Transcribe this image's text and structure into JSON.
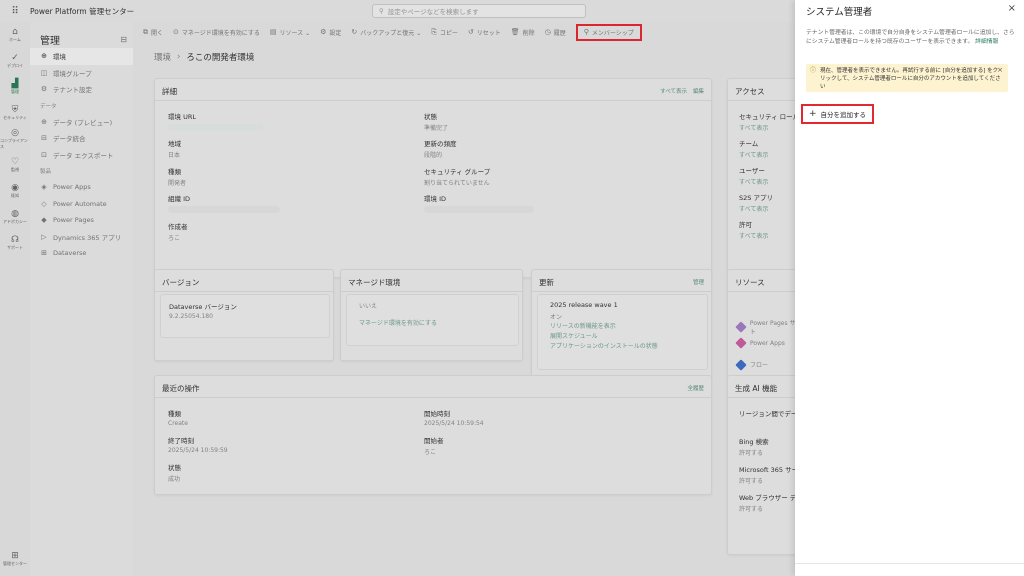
{
  "topbar": {
    "app_title": "Power Platform 管理センター",
    "search_placeholder": "設定やページなどを検索します"
  },
  "rail": {
    "items": [
      {
        "icon": "home-icon",
        "glyph": "⌂",
        "label": "ホーム"
      },
      {
        "icon": "deploy-icon",
        "glyph": "✓",
        "label": "デプロイ"
      },
      {
        "icon": "manage-icon",
        "glyph": "▟",
        "label": "管理"
      },
      {
        "icon": "security-icon",
        "glyph": "⛨",
        "label": "セキュリティ"
      },
      {
        "icon": "compliance-icon",
        "glyph": "◎",
        "label": "コンプライアンス"
      },
      {
        "icon": "monitor-icon",
        "glyph": "♡",
        "label": "監視"
      },
      {
        "icon": "reports-icon",
        "glyph": "◉",
        "label": "既知"
      },
      {
        "icon": "copilot-icon",
        "glyph": "◍",
        "label": "アドボカシー"
      },
      {
        "icon": "support-icon",
        "glyph": "☊",
        "label": "サポート"
      }
    ],
    "bottom": {
      "icon": "admin-center-icon",
      "glyph": "⊞",
      "label": "管理センター"
    }
  },
  "sidenav": {
    "title": "管理",
    "items_top": [
      {
        "glyph": "⊕",
        "label": "環境"
      },
      {
        "glyph": "◫",
        "label": "環境グループ"
      },
      {
        "glyph": "⚙",
        "label": "テナント設定"
      }
    ],
    "section_data": "データ",
    "items_data": [
      {
        "glyph": "⊕",
        "label": "データ (プレビュー)"
      },
      {
        "glyph": "⊟",
        "label": "データ統合"
      },
      {
        "glyph": "⊡",
        "label": "データ エクスポート"
      }
    ],
    "section_products": "製品",
    "items_products": [
      {
        "glyph": "◈",
        "label": "Power Apps"
      },
      {
        "glyph": "◇",
        "label": "Power Automate"
      },
      {
        "glyph": "◆",
        "label": "Power Pages"
      },
      {
        "glyph": "▷",
        "label": "Dynamics 365 アプリ"
      },
      {
        "glyph": "⊞",
        "label": "Dataverse"
      }
    ]
  },
  "cmdbar": [
    {
      "glyph": "⧉",
      "label": "開く"
    },
    {
      "glyph": "⊙",
      "label": "マネージド環境を有効にする"
    },
    {
      "glyph": "▤",
      "label": "リソース ⌄"
    },
    {
      "glyph": "⚙",
      "label": "設定"
    },
    {
      "glyph": "↻",
      "label": "バックアップと復元 ⌄"
    },
    {
      "glyph": "⎘",
      "label": "コピー"
    },
    {
      "glyph": "↺",
      "label": "リセット"
    },
    {
      "glyph": "🗑",
      "label": "削除"
    },
    {
      "glyph": "◷",
      "label": "履歴"
    },
    {
      "glyph": "⚲",
      "label": "メンバーシップ"
    }
  ],
  "breadcrumb": {
    "root": "環境",
    "current": "ろこの開発者環境"
  },
  "details": {
    "title": "詳細",
    "link_all": "すべて表示",
    "link_edit": "編集",
    "env_url_label": "環境 URL",
    "region_label": "地域",
    "region_value": "日本",
    "type_label": "種類",
    "type_value": "開発者",
    "org_id_label": "組織 ID",
    "creator_label": "作成者",
    "creator_value": "ろこ",
    "state_label": "状態",
    "state_value": "準備完了",
    "refresh_label": "更新の頻度",
    "refresh_value": "段階的",
    "secgroup_label": "セキュリティ グループ",
    "secgroup_value": "割り当てられていません",
    "env_id_label": "環境 ID"
  },
  "access": {
    "title": "アクセス",
    "items": [
      {
        "label": "セキュリティ ロール",
        "value": "すべて表示"
      },
      {
        "label": "チーム",
        "value": "すべて表示"
      },
      {
        "label": "ユーザー",
        "value": "すべて表示"
      },
      {
        "label": "S2S アプリ",
        "value": "すべて表示"
      },
      {
        "label": "許可",
        "value": "すべて表示"
      }
    ]
  },
  "version": {
    "title": "バージョン",
    "dv_label": "Dataverse バージョン",
    "dv_value": "9.2.25054.180"
  },
  "managed": {
    "title": "マネージド環境",
    "status": "いいえ",
    "enable_link": "マネージド環境を有効にする"
  },
  "updates": {
    "title": "更新",
    "manage": "管理",
    "wave": "2025 release wave 1",
    "status": "オン",
    "links": [
      "リリースの新機能を表示",
      "展開スケジュール",
      "アプリケーションのインストールの状態"
    ]
  },
  "resources": {
    "title": "リソース",
    "items": [
      {
        "label": "Power Pages サイト",
        "color": "#a07cc0"
      },
      {
        "label": "Power Apps",
        "color": "#c85fa0"
      },
      {
        "label": "フロー",
        "color": "#3f6fc4"
      }
    ]
  },
  "recent": {
    "title": "最近の操作",
    "link_all": "全履歴",
    "type_label": "種類",
    "type_value": "Create",
    "start_label": "開始時刻",
    "start_value": "2025/5/24 10:59:54",
    "end_label": "終了時刻",
    "end_value": "2025/5/24 10:59:59",
    "initiator_label": "開始者",
    "initiator_value": "ろこ",
    "status_label": "状態",
    "status_value": "成功"
  },
  "genai": {
    "title": "生成 AI 機能",
    "items": [
      {
        "label": "リージョン間でデータを移動",
        "value": ""
      },
      {
        "label": "Bing 検索",
        "value": "許可する"
      },
      {
        "label": "Microsoft 365 サービス",
        "value": "許可する"
      },
      {
        "label": "Web ブラウザー データ",
        "value": "許可する"
      }
    ]
  },
  "panel": {
    "title": "システム管理者",
    "close": "×",
    "desc": "テナント管理者は、この環境で自分自身をシステム管理者ロールに追加し、さらにシステム管理者ロールを持つ既存のユーザーを表示できます。",
    "desc_link": "詳細情報",
    "warning": "現在、管理者を表示できません。再試行する前に [自分を追加する] をクリックして、システム管理者ロールに自分のアカウントを追加してください",
    "add_self": "自分を追加する"
  },
  "colors": {
    "accent": "#2c7a57",
    "highlight": "#e3282f",
    "warning_bg": "#fdf3d0"
  }
}
